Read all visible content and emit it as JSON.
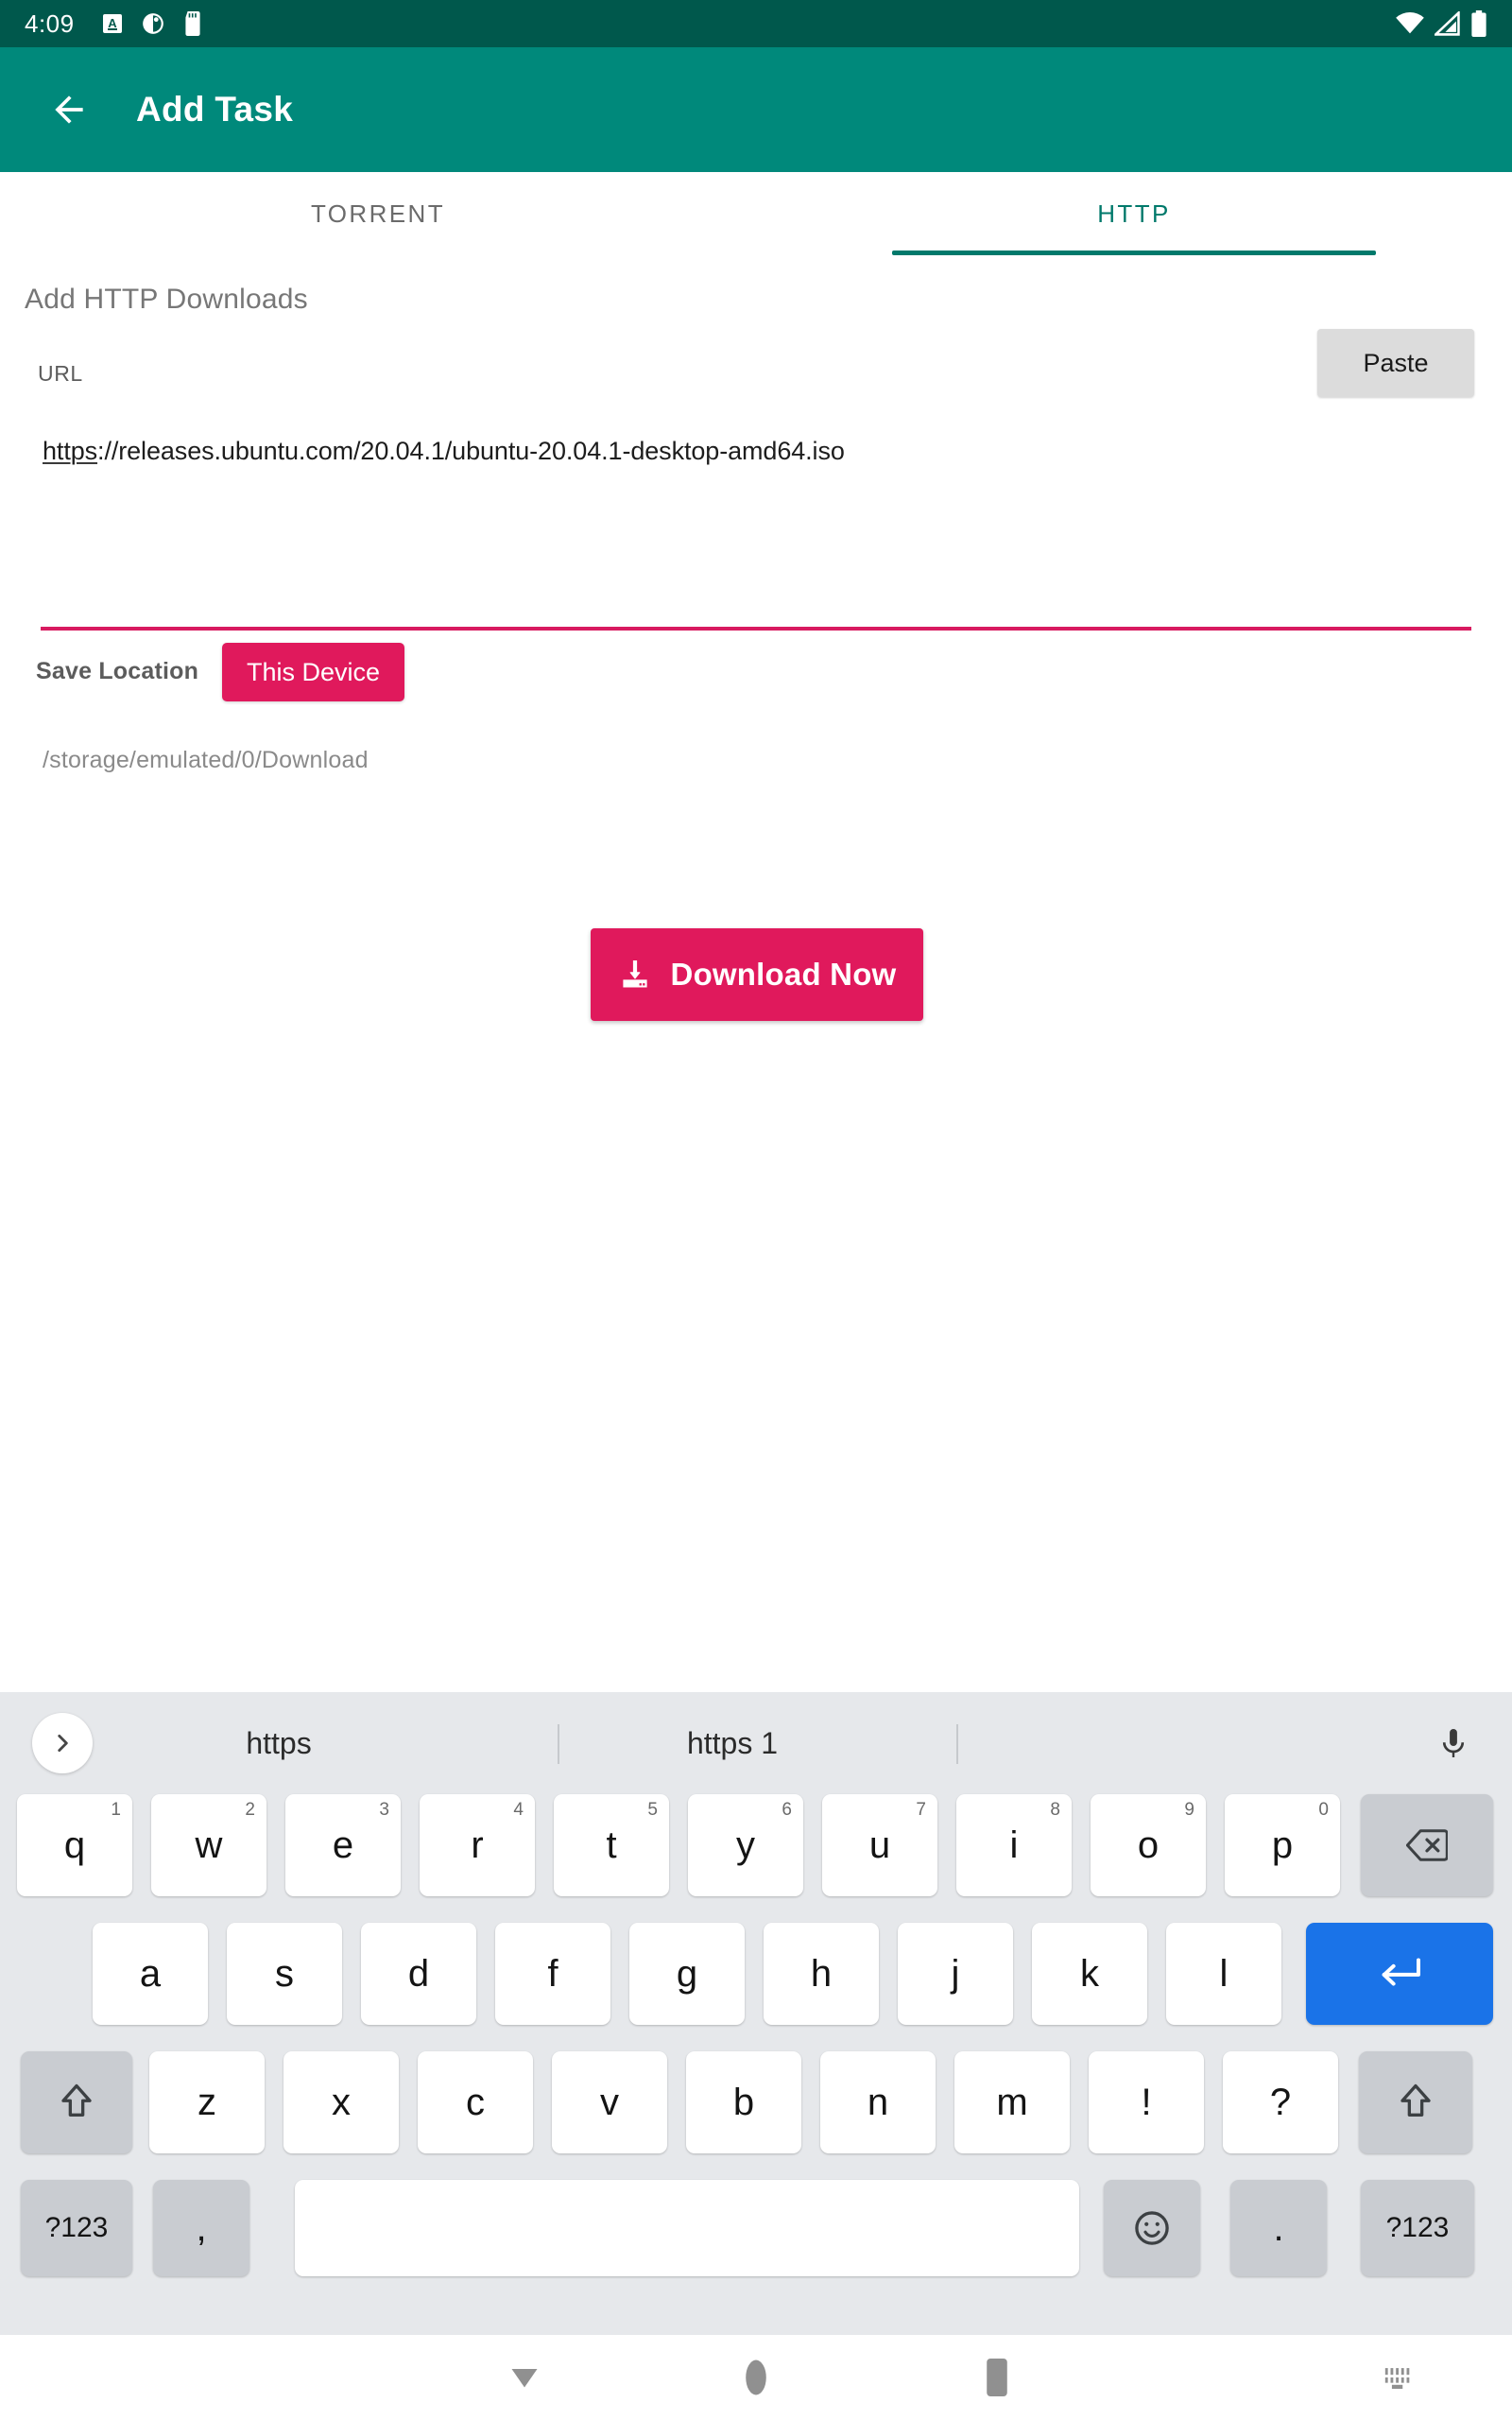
{
  "status_bar": {
    "time": "4:09",
    "left_icons": [
      "letter-a-badge-icon",
      "half-circle-icon",
      "sd-card-icon"
    ],
    "right_icons": [
      "wifi-icon",
      "cellular-signal-icon",
      "battery-icon"
    ],
    "background_color": "#00584c"
  },
  "app_bar": {
    "back_icon": "arrow-back-icon",
    "title": "Add Task",
    "background_color": "#00897b"
  },
  "tabs": {
    "items": [
      {
        "label": "TORRENT",
        "active": false
      },
      {
        "label": "HTTP",
        "active": true
      }
    ],
    "active_color": "#00796b",
    "inactive_color": "#6b6b6b"
  },
  "form": {
    "section_title": "Add HTTP Downloads",
    "url_label": "URL",
    "paste_label": "Paste",
    "url_value_spell": "https",
    "url_value_rest": "://releases.ubuntu.com/20.04.1/ubuntu-20.04.1-desktop-amd64.iso",
    "url_value_full": "https://releases.ubuntu.com/20.04.1/ubuntu-20.04.1-desktop-amd64.iso",
    "url_underline_color": "#d81b60",
    "save_location_label": "Save Location",
    "save_location_value": "This Device",
    "save_path": "/storage/emulated/0/Download",
    "download_button_label": "Download Now",
    "download_icon": "download-to-tray-icon",
    "accent_color": "#e0195c"
  },
  "keyboard": {
    "background_color": "#e6e8eb",
    "expand_icon": "chevron-right-icon",
    "mic_icon": "microphone-icon",
    "suggestions": [
      "https",
      "https 1"
    ],
    "rows": [
      [
        {
          "label": "q",
          "hint": "1"
        },
        {
          "label": "w",
          "hint": "2"
        },
        {
          "label": "e",
          "hint": "3"
        },
        {
          "label": "r",
          "hint": "4"
        },
        {
          "label": "t",
          "hint": "5"
        },
        {
          "label": "y",
          "hint": "6"
        },
        {
          "label": "u",
          "hint": "7"
        },
        {
          "label": "i",
          "hint": "8"
        },
        {
          "label": "o",
          "hint": "9"
        },
        {
          "label": "p",
          "hint": "0"
        },
        {
          "label": "",
          "icon": "backspace-icon",
          "style": "gray"
        }
      ],
      [
        {
          "label": "a"
        },
        {
          "label": "s"
        },
        {
          "label": "d"
        },
        {
          "label": "f"
        },
        {
          "label": "g"
        },
        {
          "label": "h"
        },
        {
          "label": "j"
        },
        {
          "label": "k"
        },
        {
          "label": "l"
        },
        {
          "label": "",
          "icon": "enter-icon",
          "style": "blue"
        }
      ],
      [
        {
          "label": "",
          "icon": "shift-icon",
          "style": "gray"
        },
        {
          "label": "z"
        },
        {
          "label": "x"
        },
        {
          "label": "c"
        },
        {
          "label": "v"
        },
        {
          "label": "b"
        },
        {
          "label": "n"
        },
        {
          "label": "m"
        },
        {
          "label": "!"
        },
        {
          "label": "?"
        },
        {
          "label": "",
          "icon": "shift-icon",
          "style": "gray"
        }
      ],
      [
        {
          "label": "?123",
          "style": "gray"
        },
        {
          "label": ",",
          "style": "gray"
        },
        {
          "label": "",
          "style": "space"
        },
        {
          "label": "",
          "icon": "emoji-icon",
          "style": "gray"
        },
        {
          "label": ".",
          "style": "gray"
        },
        {
          "label": "?123",
          "style": "gray"
        }
      ]
    ]
  },
  "nav_bar": {
    "items": [
      {
        "name": "back-down-icon"
      },
      {
        "name": "home-circle-icon"
      },
      {
        "name": "recents-square-icon"
      },
      {
        "name": "keyboard-switcher-icon"
      }
    ],
    "icon_color": "#909090"
  }
}
